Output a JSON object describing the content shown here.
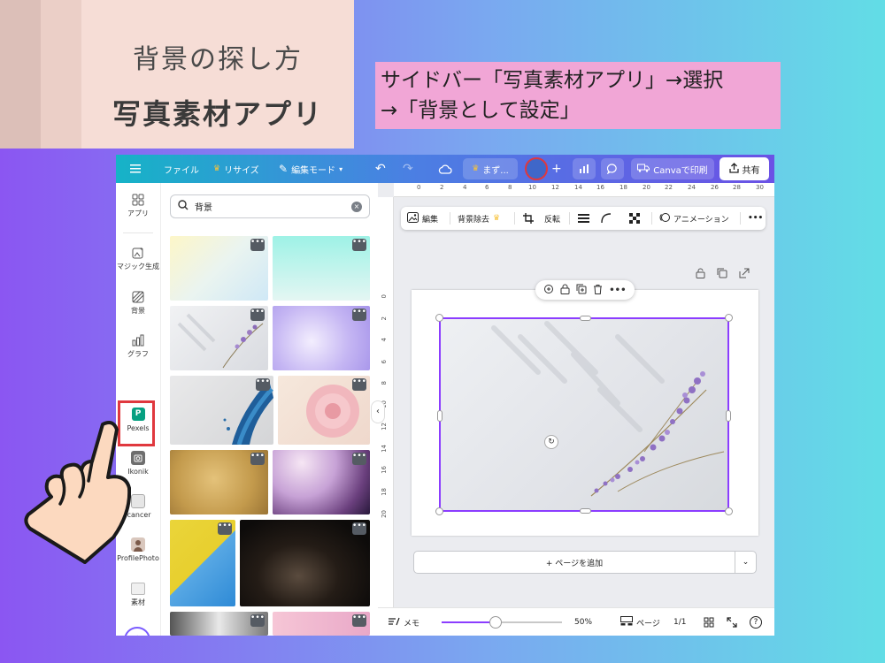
{
  "title_card": {
    "subtitle": "背景の探し方",
    "title": "写真素材アプリ"
  },
  "note": {
    "line1": "サイドバー「写真素材アプリ」→選択",
    "line2": "→「背景として設定」"
  },
  "topbar": {
    "file": "ファイル",
    "resize": "リサイズ",
    "edit_mode": "編集モード",
    "doc_name": "まず...",
    "print": "Canvaで印刷",
    "share": "共有"
  },
  "rail": {
    "apps": "アプリ",
    "magic": "マジック生成",
    "background": "背景",
    "graph": "グラフ",
    "pexels": "Pexels",
    "ikonik": "Ikonik",
    "icancer": "icancer",
    "profilephoto": "ProfilePhoto",
    "materials": "素材"
  },
  "panel": {
    "search_value": "背景",
    "more": "•••"
  },
  "ruler": {
    "top": [
      "0",
      "2",
      "4",
      "6",
      "8",
      "10",
      "12",
      "14",
      "16",
      "18",
      "20",
      "22",
      "24",
      "26",
      "28",
      "30"
    ],
    "left": [
      "0",
      "2",
      "4",
      "6",
      "8",
      "10",
      "12",
      "14",
      "16",
      "18",
      "20"
    ]
  },
  "ctx_toolbar": {
    "edit": "編集",
    "bg_remove": "背景除去",
    "flip": "反転",
    "animation": "アニメーション",
    "more": "•••"
  },
  "canvas": {
    "add_page": "+ ページを追加"
  },
  "footer": {
    "memo": "メモ",
    "zoom": "50%",
    "zoom_level": 0.45,
    "page_label": "ページ",
    "page_count": "1/1"
  },
  "colors": {
    "accent": "#8b3dff",
    "highlight_red": "#e0383e",
    "note_pink": "#f1a6d6",
    "pexels_green": "#07a081"
  }
}
